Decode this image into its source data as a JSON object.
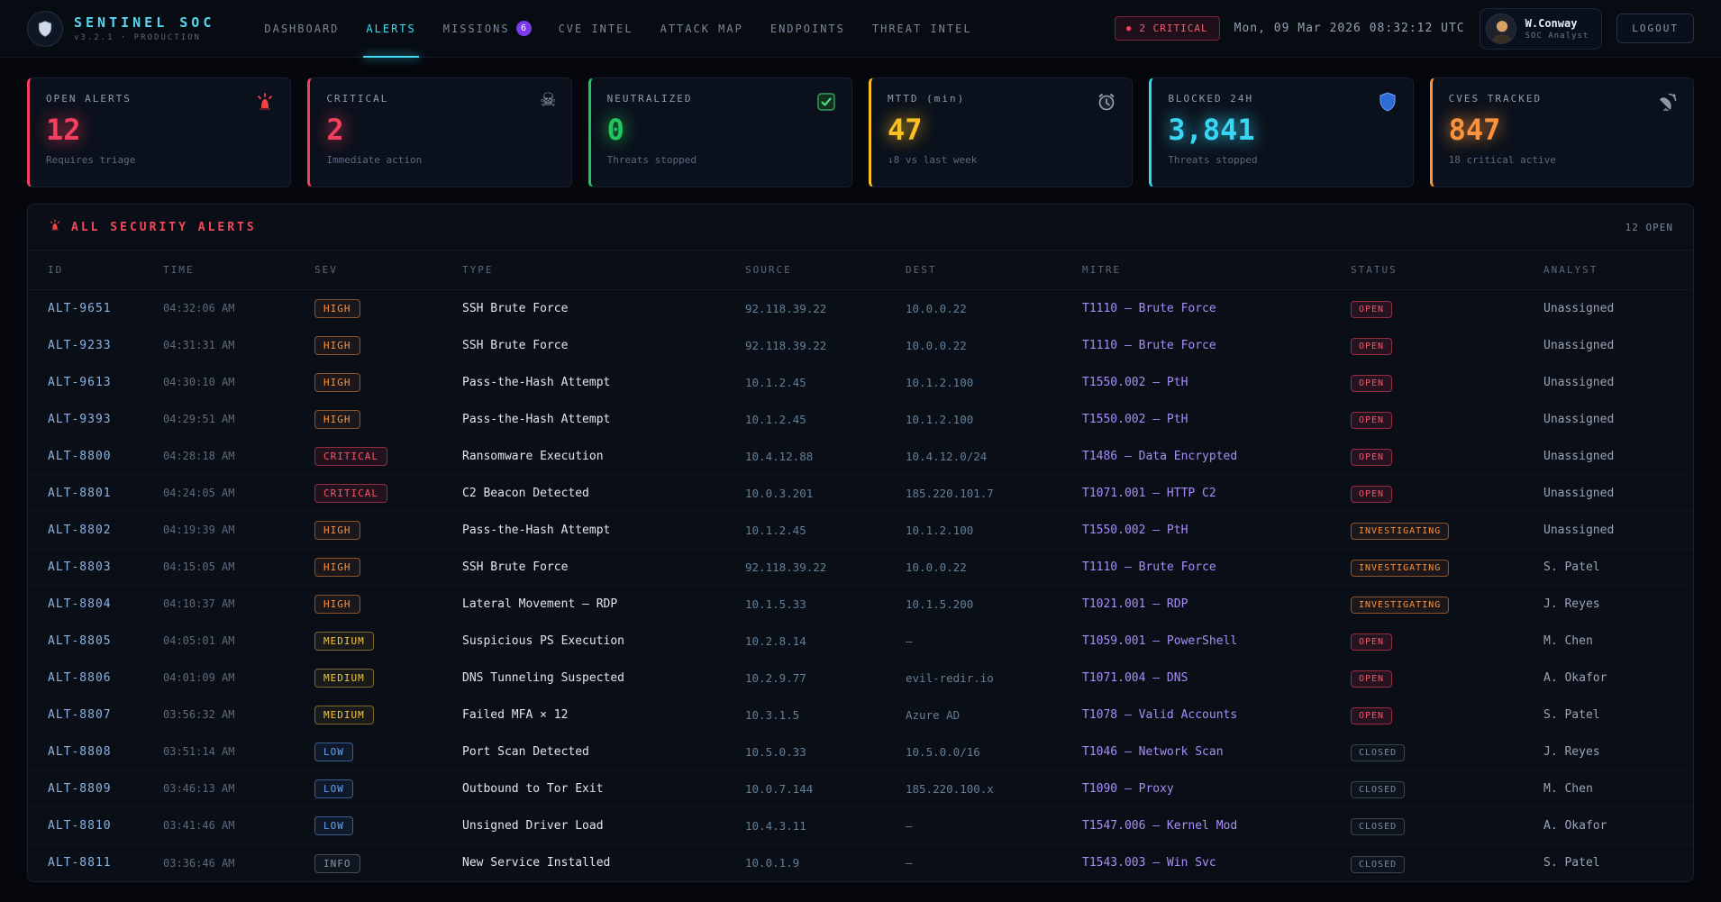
{
  "brand": {
    "title": "SENTINEL SOC",
    "subtitle": "v3.2.1 · PRODUCTION"
  },
  "nav": {
    "items": [
      {
        "label": "DASHBOARD",
        "active": false
      },
      {
        "label": "ALERTS",
        "active": true
      },
      {
        "label": "MISSIONS",
        "active": false,
        "badge": "6"
      },
      {
        "label": "CVE INTEL",
        "active": false
      },
      {
        "label": "ATTACK MAP",
        "active": false
      },
      {
        "label": "ENDPOINTS",
        "active": false
      },
      {
        "label": "THREAT INTEL",
        "active": false
      }
    ]
  },
  "header_right": {
    "critical_badge": "2 CRITICAL",
    "clock": "Mon, 09 Mar 2026 08:32:12 UTC",
    "user_name": "W.Conway",
    "user_role": "SOC Analyst",
    "logout_label": "LOGOUT"
  },
  "stats": [
    {
      "label": "OPEN ALERTS",
      "value": "12",
      "sub": "Requires triage",
      "color": "#f43f5e",
      "icon": "siren-icon"
    },
    {
      "label": "CRITICAL",
      "value": "2",
      "sub": "Immediate action",
      "color": "#f43f5e",
      "icon": "skull-icon"
    },
    {
      "label": "NEUTRALIZED",
      "value": "0",
      "sub": "Threats stopped",
      "color": "#22c55e",
      "icon": "check-icon"
    },
    {
      "label": "MTTD (min)",
      "value": "47",
      "sub": "↓8 vs last week",
      "color": "#fbbf24",
      "icon": "alarm-clock-icon"
    },
    {
      "label": "BLOCKED 24H",
      "value": "3,841",
      "sub": "Threats stopped",
      "color": "#38d6f5",
      "icon": "shield-icon"
    },
    {
      "label": "CVES TRACKED",
      "value": "847",
      "sub": "18 critical active",
      "color": "#fb923c",
      "icon": "satellite-icon"
    }
  ],
  "panel": {
    "title": "ALL SECURITY ALERTS",
    "open_count": "12 OPEN",
    "columns": [
      "ID",
      "TIME",
      "SEV",
      "TYPE",
      "SOURCE",
      "DEST",
      "MITRE",
      "STATUS",
      "ANALYST"
    ],
    "rows": [
      {
        "id": "ALT-9651",
        "time": "04:32:06 AM",
        "sev": "HIGH",
        "type": "SSH Brute Force",
        "source": "92.118.39.22",
        "dest": "10.0.0.22",
        "mitre": "T1110 – Brute Force",
        "status": "OPEN",
        "analyst": "Unassigned"
      },
      {
        "id": "ALT-9233",
        "time": "04:31:31 AM",
        "sev": "HIGH",
        "type": "SSH Brute Force",
        "source": "92.118.39.22",
        "dest": "10.0.0.22",
        "mitre": "T1110 – Brute Force",
        "status": "OPEN",
        "analyst": "Unassigned"
      },
      {
        "id": "ALT-9613",
        "time": "04:30:10 AM",
        "sev": "HIGH",
        "type": "Pass-the-Hash Attempt",
        "source": "10.1.2.45",
        "dest": "10.1.2.100",
        "mitre": "T1550.002 – PtH",
        "status": "OPEN",
        "analyst": "Unassigned"
      },
      {
        "id": "ALT-9393",
        "time": "04:29:51 AM",
        "sev": "HIGH",
        "type": "Pass-the-Hash Attempt",
        "source": "10.1.2.45",
        "dest": "10.1.2.100",
        "mitre": "T1550.002 – PtH",
        "status": "OPEN",
        "analyst": "Unassigned"
      },
      {
        "id": "ALT-8800",
        "time": "04:28:18 AM",
        "sev": "CRITICAL",
        "type": "Ransomware Execution",
        "source": "10.4.12.88",
        "dest": "10.4.12.0/24",
        "mitre": "T1486 – Data Encrypted",
        "status": "OPEN",
        "analyst": "Unassigned"
      },
      {
        "id": "ALT-8801",
        "time": "04:24:05 AM",
        "sev": "CRITICAL",
        "type": "C2 Beacon Detected",
        "source": "10.0.3.201",
        "dest": "185.220.101.7",
        "mitre": "T1071.001 – HTTP C2",
        "status": "OPEN",
        "analyst": "Unassigned"
      },
      {
        "id": "ALT-8802",
        "time": "04:19:39 AM",
        "sev": "HIGH",
        "type": "Pass-the-Hash Attempt",
        "source": "10.1.2.45",
        "dest": "10.1.2.100",
        "mitre": "T1550.002 – PtH",
        "status": "INVESTIGATING",
        "analyst": "Unassigned"
      },
      {
        "id": "ALT-8803",
        "time": "04:15:05 AM",
        "sev": "HIGH",
        "type": "SSH Brute Force",
        "source": "92.118.39.22",
        "dest": "10.0.0.22",
        "mitre": "T1110 – Brute Force",
        "status": "INVESTIGATING",
        "analyst": "S. Patel"
      },
      {
        "id": "ALT-8804",
        "time": "04:10:37 AM",
        "sev": "HIGH",
        "type": "Lateral Movement – RDP",
        "source": "10.1.5.33",
        "dest": "10.1.5.200",
        "mitre": "T1021.001 – RDP",
        "status": "INVESTIGATING",
        "analyst": "J. Reyes"
      },
      {
        "id": "ALT-8805",
        "time": "04:05:01 AM",
        "sev": "MEDIUM",
        "type": "Suspicious PS Execution",
        "source": "10.2.8.14",
        "dest": "—",
        "mitre": "T1059.001 – PowerShell",
        "status": "OPEN",
        "analyst": "M. Chen"
      },
      {
        "id": "ALT-8806",
        "time": "04:01:09 AM",
        "sev": "MEDIUM",
        "type": "DNS Tunneling Suspected",
        "source": "10.2.9.77",
        "dest": "evil-redir.io",
        "mitre": "T1071.004 – DNS",
        "status": "OPEN",
        "analyst": "A. Okafor"
      },
      {
        "id": "ALT-8807",
        "time": "03:56:32 AM",
        "sev": "MEDIUM",
        "type": "Failed MFA × 12",
        "source": "10.3.1.5",
        "dest": "Azure AD",
        "mitre": "T1078 – Valid Accounts",
        "status": "OPEN",
        "analyst": "S. Patel"
      },
      {
        "id": "ALT-8808",
        "time": "03:51:14 AM",
        "sev": "LOW",
        "type": "Port Scan Detected",
        "source": "10.5.0.33",
        "dest": "10.5.0.0/16",
        "mitre": "T1046 – Network Scan",
        "status": "CLOSED",
        "analyst": "J. Reyes"
      },
      {
        "id": "ALT-8809",
        "time": "03:46:13 AM",
        "sev": "LOW",
        "type": "Outbound to Tor Exit",
        "source": "10.0.7.144",
        "dest": "185.220.100.x",
        "mitre": "T1090 – Proxy",
        "status": "CLOSED",
        "analyst": "M. Chen"
      },
      {
        "id": "ALT-8810",
        "time": "03:41:46 AM",
        "sev": "LOW",
        "type": "Unsigned Driver Load",
        "source": "10.4.3.11",
        "dest": "—",
        "mitre": "T1547.006 – Kernel Mod",
        "status": "CLOSED",
        "analyst": "A. Okafor"
      },
      {
        "id": "ALT-8811",
        "time": "03:36:46 AM",
        "sev": "INFO",
        "type": "New Service Installed",
        "source": "10.0.1.9",
        "dest": "—",
        "mitre": "T1543.003 – Win Svc",
        "status": "CLOSED",
        "analyst": "S. Patel"
      }
    ]
  }
}
